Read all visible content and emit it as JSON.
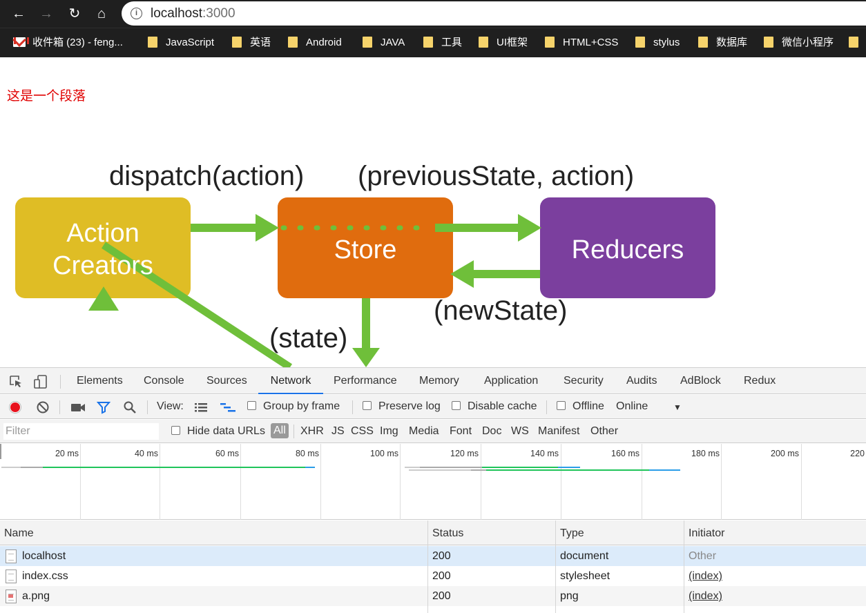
{
  "browser": {
    "url_host": "localhost",
    "url_port": ":3000",
    "bookmarks": [
      {
        "label": "收件箱 (23) - feng...",
        "icon": "gmail-icon"
      },
      {
        "label": "JavaScript",
        "icon": "folder-icon"
      },
      {
        "label": "英语",
        "icon": "folder-icon"
      },
      {
        "label": "Android",
        "icon": "folder-icon"
      },
      {
        "label": "JAVA",
        "icon": "folder-icon"
      },
      {
        "label": "工具",
        "icon": "folder-icon"
      },
      {
        "label": "UI框架",
        "icon": "folder-icon"
      },
      {
        "label": "HTML+CSS",
        "icon": "folder-icon"
      },
      {
        "label": "stylus",
        "icon": "folder-icon"
      },
      {
        "label": "数据库",
        "icon": "folder-icon"
      },
      {
        "label": "微信小程序",
        "icon": "folder-icon"
      }
    ]
  },
  "page": {
    "paragraph": "这是一个段落",
    "diagram": {
      "label_dispatch": "dispatch(action)",
      "label_previous": "(previousState, action)",
      "label_newstate": "(newState)",
      "label_state": "(state)",
      "box_action_line1": "Action",
      "box_action_line2": "Creators",
      "box_store": "Store",
      "box_reducers": "Reducers",
      "colors": {
        "action": "#dfbd25",
        "store": "#e06c0e",
        "reducers": "#7b3f9e",
        "arrow": "#6fbf3a"
      }
    }
  },
  "devtools": {
    "tabs": [
      "Elements",
      "Console",
      "Sources",
      "Network",
      "Performance",
      "Memory",
      "Application",
      "Security",
      "Audits",
      "AdBlock",
      "Redux"
    ],
    "active_tab": "Network",
    "toolbar": {
      "view_label": "View:",
      "group_by_frame": "Group by frame",
      "preserve_log": "Preserve log",
      "disable_cache": "Disable cache",
      "offline": "Offline",
      "throttle": "Online"
    },
    "filter": {
      "placeholder": "Filter",
      "hide_data_urls": "Hide data URLs",
      "types": [
        "All",
        "XHR",
        "JS",
        "CSS",
        "Img",
        "Media",
        "Font",
        "Doc",
        "WS",
        "Manifest",
        "Other"
      ]
    },
    "timeline": {
      "ticks": [
        "20 ms",
        "40 ms",
        "60 ms",
        "80 ms",
        "100 ms",
        "120 ms",
        "140 ms",
        "160 ms",
        "180 ms",
        "200 ms",
        "220"
      ]
    },
    "table": {
      "headers": [
        "Name",
        "Status",
        "Type",
        "Initiator"
      ],
      "rows": [
        {
          "name": "localhost",
          "status": "200",
          "type": "document",
          "initiator": "Other"
        },
        {
          "name": "index.css",
          "status": "200",
          "type": "stylesheet",
          "initiator": "(index)"
        },
        {
          "name": "a.png",
          "status": "200",
          "type": "png",
          "initiator": "(index)"
        }
      ]
    }
  }
}
